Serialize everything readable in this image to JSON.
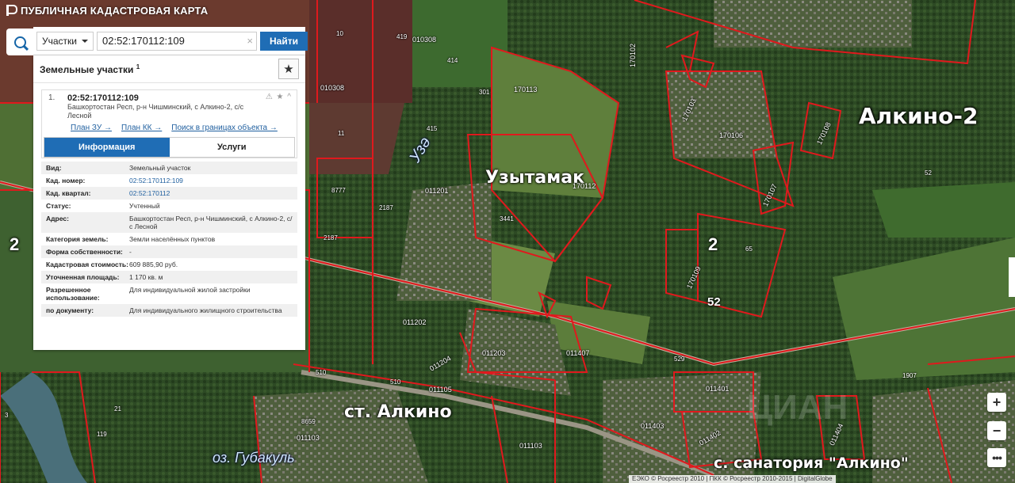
{
  "app": {
    "title": "ПУБЛИЧНАЯ КАДАСТРОВАЯ КАРТА"
  },
  "search": {
    "type_label": "Участки",
    "query": "02:52:170112:109",
    "clear_symbol": "×",
    "button_label": "Найти"
  },
  "panel": {
    "title": "Земельные участки",
    "title_count": "1",
    "favorite_symbol": "★"
  },
  "result": {
    "index": "1.",
    "cadastral_number": "02:52:170112:109",
    "address_short": "Башкортостан Респ, р-н Чишминский, с Алкино-2, с/с Лесной",
    "status_icons": "⚠ ★ ^",
    "links": [
      "План ЗУ →",
      "План КК →",
      "Поиск в границах объекта →"
    ],
    "tabs": [
      "Информация",
      "Услуги"
    ]
  },
  "info": [
    {
      "key": "Вид:",
      "value": "Земельный участок"
    },
    {
      "key": "Кад. номер:",
      "value": "02:52:170112:109"
    },
    {
      "key": "Кад. квартал:",
      "value": "02:52:170112"
    },
    {
      "key": "Статус:",
      "value": "Учтенный"
    },
    {
      "key": "Адрес:",
      "value": "Башкортостан Респ, р-н Чишминский, с Алкино-2, с/с Лесной"
    },
    {
      "key": "Категория земель:",
      "value": "Земли населённых пунктов"
    },
    {
      "key": "Форма собственности:",
      "value": "-"
    },
    {
      "key": "Кадастровая стоимость:",
      "value": "609 885,90 руб."
    },
    {
      "key": "Уточненная площадь:",
      "value": "1 170 кв. м"
    },
    {
      "key": "Разрешенное использование:",
      "value": "Для индивидуальной жилой застройки"
    },
    {
      "key": "по документу:",
      "value": "Для индивидуального жилищного строительства"
    }
  ],
  "map_labels": {
    "alkino2": "Алкино-2",
    "uzytamak": "Узытамак",
    "st_alkino": "ст. Алкино",
    "sanatorium": "с. санатория \"Алкино\"",
    "lake": "оз. Губакуль",
    "river": "Узә",
    "n2_left": "2",
    "n2_mid": "2",
    "n52": "52",
    "parcels": {
      "p010308a": "010308",
      "p010308b": "010308",
      "p170113": "170113",
      "p170112": "170112",
      "p170106": "170106",
      "p170102": "170102",
      "p170103": "170103",
      "p170108": "170108",
      "p170107": "170107",
      "p170109": "170109",
      "p011201": "011201",
      "p011202": "011202",
      "p011203": "011203",
      "p011204": "011204",
      "p011407": "011407",
      "p011105": "011105",
      "p011103": "011103",
      "p011103b": "011103",
      "p011403": "011403",
      "p011401": "011401",
      "p011402": "011402",
      "p011404": "011404",
      "p3441": "3441",
      "p2187a": "2187",
      "p2187b": "2187",
      "p8777": "8777",
      "p8659": "8659",
      "p1907": "1907",
      "p529": "529",
      "p510a": "510",
      "p510b": "510",
      "p419": "419",
      "p414": "414",
      "p415": "415",
      "p301": "301",
      "p10": "10",
      "p11": "11",
      "p52r": "52",
      "p65": "65",
      "p21": "21",
      "p3": "3",
      "p119": "119"
    }
  },
  "controls": {
    "zoom_in": "+",
    "zoom_out": "−",
    "more": "•••"
  },
  "attribution": "ЕЭКО © Росреестр 2010 | ПКК © Росреестр 2010-2015 | DigitalGlobe",
  "colors": {
    "accent": "#1f6db5",
    "parcel_border": "#e0191d",
    "forest": "#2f4a26",
    "field": "#5b7a3a"
  }
}
